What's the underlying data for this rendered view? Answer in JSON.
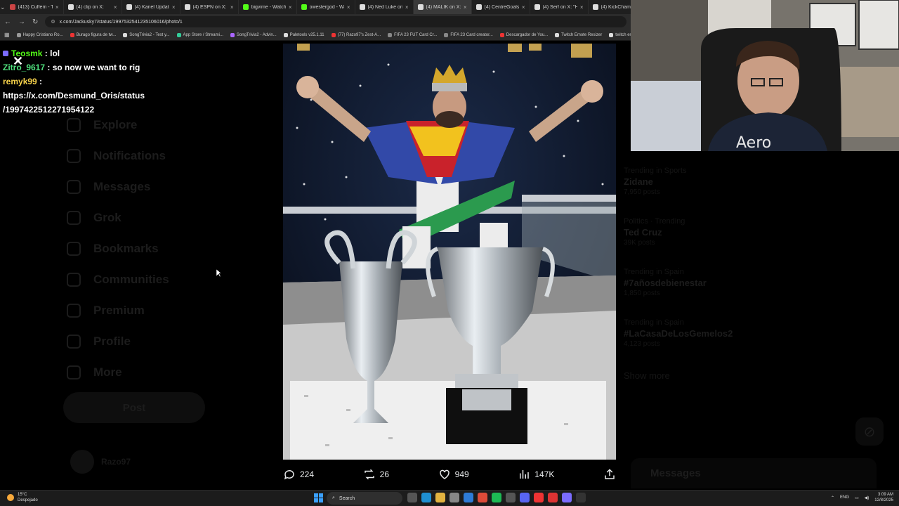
{
  "browser": {
    "tabs": [
      {
        "title": "(413) Cuffem - Tw",
        "color": "#c44",
        "active": false
      },
      {
        "title": "(4) clip on X:",
        "color": "#ddd",
        "active": false
      },
      {
        "title": "(4) Kanel Update:",
        "color": "#ddd",
        "active": false
      },
      {
        "title": "(4) ESPN on X: \"T",
        "color": "#ddd",
        "active": false
      },
      {
        "title": "bigvime - Watch",
        "color": "#53fc18",
        "active": false
      },
      {
        "title": "owestergod - Wat",
        "color": "#53fc18",
        "active": false
      },
      {
        "title": "(4) Ned Luke on",
        "color": "#ddd",
        "active": false
      },
      {
        "title": "(4) MALIK on X:",
        "color": "#ddd",
        "active": true
      },
      {
        "title": "(4) CentreGoals",
        "color": "#ddd",
        "active": false
      },
      {
        "title": "(4) Serf on X: \"H",
        "color": "#ddd",
        "active": false
      },
      {
        "title": "(4) KickChamp",
        "color": "#ddd",
        "active": false
      }
    ],
    "url": "x.com/Jackusky7/status/1997532541235106016/photo/1",
    "bookmarks": [
      {
        "label": "Happy Cristiano Ro...",
        "color": "#999"
      },
      {
        "label": "Burago figura de tw...",
        "color": "#e33"
      },
      {
        "label": "SongTrivia2 - Test y...",
        "color": "#ddd"
      },
      {
        "label": "App Store / Streami...",
        "color": "#3c9"
      },
      {
        "label": "SongTrivia2 - Advin...",
        "color": "#a6f"
      },
      {
        "label": "Paletools v25.1.11",
        "color": "#ddd"
      },
      {
        "label": "(77) Razo97's Zest-A...",
        "color": "#e33"
      },
      {
        "label": "FIFA 23 FUT Card Cr...",
        "color": "#888"
      },
      {
        "label": "FIFA 23 Card creator...",
        "color": "#888"
      },
      {
        "label": "Descargador de You...",
        "color": "#e33"
      },
      {
        "label": "Twitch Emote Resizer",
        "color": "#ddd"
      },
      {
        "label": "twitch em",
        "color": "#ddd"
      }
    ]
  },
  "x_sidebar": {
    "items": [
      "Explore",
      "Notifications",
      "Messages",
      "Grok",
      "Bookmarks",
      "Communities",
      "Premium",
      "Profile",
      "More"
    ],
    "post_label": "Post",
    "username": "Razo97"
  },
  "trends": [
    {
      "category": "Trending in Sports",
      "name": "Zidane",
      "count": "7,950 posts"
    },
    {
      "category": "Politics · Trending",
      "name": "Ted Cruz",
      "count": "39K posts"
    },
    {
      "category": "Trending in Spain",
      "name": "#7añosdebienestar",
      "count": "1,850 posts"
    },
    {
      "category": "Trending in Spain",
      "name": "#LaCasaDeLosGemelos2",
      "count": "4,123 posts"
    }
  ],
  "show_more": "Show more",
  "messages_label": "Messages",
  "chat": [
    {
      "user": "Teosmk",
      "text": "lol",
      "badge": true
    },
    {
      "user": "Zitro_9617",
      "text": "so now we want to rig",
      "badge": false
    },
    {
      "user": "remyk99",
      "text": "",
      "badge": false
    },
    {
      "user": "",
      "text": "https://x.com/Desmund_Oris/status",
      "badge": false
    },
    {
      "user": "",
      "text": "/1997422512271954122",
      "badge": false
    }
  ],
  "post_actions": {
    "replies": "224",
    "reposts": "26",
    "likes": "949",
    "views": "147K"
  },
  "taskbar": {
    "weather_temp": "15°C",
    "weather_desc": "Despejado",
    "search_label": "Search",
    "lang": "ENG",
    "time": "3:09 AM",
    "date": "12/8/2025"
  }
}
